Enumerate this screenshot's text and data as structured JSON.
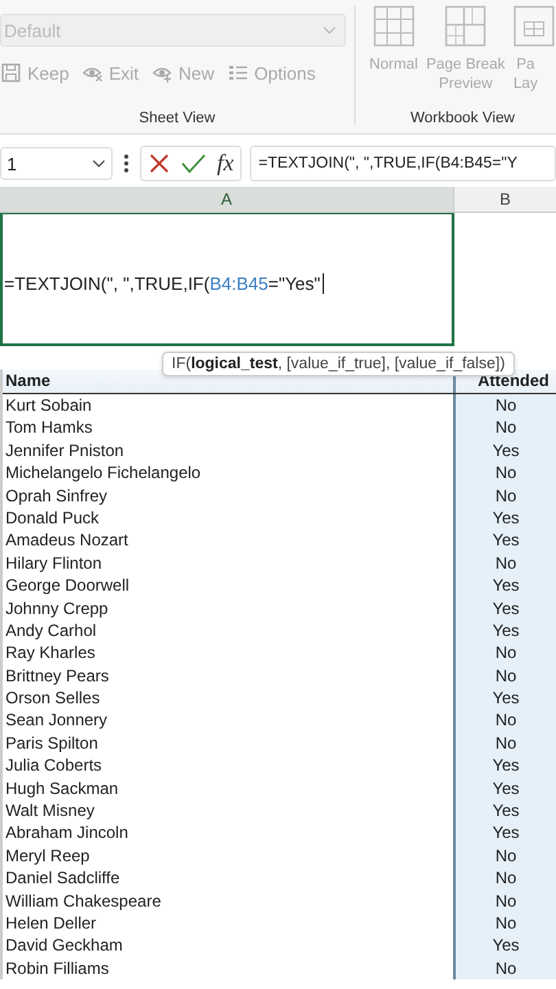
{
  "ribbon": {
    "style_dropdown": {
      "value": "Default",
      "disabled": true
    },
    "sheet_view": {
      "label": "Sheet View",
      "buttons": [
        {
          "kind": "keep",
          "label": "Keep",
          "disabled": true
        },
        {
          "kind": "exit",
          "label": "Exit",
          "disabled": true
        },
        {
          "kind": "new",
          "label": "New",
          "disabled": true
        },
        {
          "kind": "options",
          "label": "Options",
          "disabled": true
        }
      ]
    },
    "workbook_view": {
      "label": "Workbook View",
      "buttons": [
        {
          "kind": "normal",
          "lines": [
            "Normal"
          ],
          "disabled": true
        },
        {
          "kind": "pagebreak",
          "lines": [
            "Page Break",
            "Preview"
          ],
          "disabled": true
        },
        {
          "kind": "layout",
          "lines": [
            "Pa",
            "Lay"
          ],
          "disabled": true
        }
      ]
    }
  },
  "formula_bar": {
    "name_box": "1",
    "insert_function": "fx",
    "formula": "=TEXTJOIN(\", \",TRUE,IF(B4:B45=\"Y"
  },
  "column_headers": [
    {
      "label": "A",
      "selected": true
    },
    {
      "label": "B",
      "selected": false
    }
  ],
  "edit_cell": {
    "parts": [
      {
        "kind": "plain",
        "text": "=TEXTJOIN(\", \",TRUE,IF("
      },
      {
        "kind": "reference",
        "text": "B4:B45"
      },
      {
        "kind": "plain",
        "text": "=\"Yes\""
      }
    ]
  },
  "tooltip": "IF(**logical_test**, [value_if_true], [value_if_false])",
  "table": {
    "columns": [
      "Name",
      "Attended"
    ],
    "rows": [
      [
        "Kurt Sobain",
        "No"
      ],
      [
        "Tom Hamks",
        "No"
      ],
      [
        "Jennifer Pniston",
        "Yes"
      ],
      [
        "Michelangelo Fichelangelo",
        "No"
      ],
      [
        "Oprah Sinfrey",
        "No"
      ],
      [
        "Donald Puck",
        "Yes"
      ],
      [
        "Amadeus Nozart",
        "Yes"
      ],
      [
        "Hilary Flinton",
        "No"
      ],
      [
        "George Doorwell",
        "Yes"
      ],
      [
        "Johnny Crepp",
        "Yes"
      ],
      [
        "Andy Carhol",
        "Yes"
      ],
      [
        "Ray Kharles",
        "No"
      ],
      [
        "Brittney Pears",
        "No"
      ],
      [
        "Orson Selles",
        "Yes"
      ],
      [
        "Sean Jonnery",
        "No"
      ],
      [
        "Paris Spilton",
        "No"
      ],
      [
        "Julia Coberts",
        "Yes"
      ],
      [
        "Hugh Sackman",
        "Yes"
      ],
      [
        "Walt Misney",
        "Yes"
      ],
      [
        "Abraham Jincoln",
        "Yes"
      ],
      [
        "Meryl Reep",
        "No"
      ],
      [
        "Daniel Sadcliffe",
        "No"
      ],
      [
        "William Chakespeare",
        "No"
      ],
      [
        "Helen Deller",
        "No"
      ],
      [
        "David Geckham",
        "Yes"
      ],
      [
        "Robin Filliams",
        "No"
      ]
    ]
  }
}
